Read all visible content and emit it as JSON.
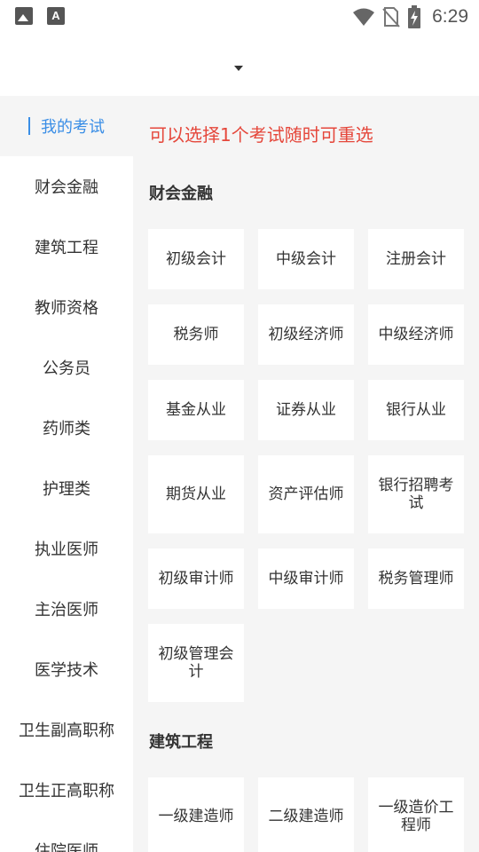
{
  "status_bar": {
    "time": "6:29",
    "left_icons": [
      "image-icon",
      "text-a-icon"
    ],
    "right_icons": [
      "wifi-icon",
      "no-sim-icon",
      "battery-charging-icon"
    ],
    "a_glyph": "A"
  },
  "header": {
    "title": "",
    "dropdown_icon": "caret-down-icon"
  },
  "sidebar": {
    "items": [
      {
        "label": "我的考试",
        "active": true
      },
      {
        "label": "财会金融"
      },
      {
        "label": "建筑工程"
      },
      {
        "label": "教师资格"
      },
      {
        "label": "公务员"
      },
      {
        "label": "药师类"
      },
      {
        "label": "护理类"
      },
      {
        "label": "执业医师"
      },
      {
        "label": "主治医师"
      },
      {
        "label": "医学技术"
      },
      {
        "label": "卫生副高职称"
      },
      {
        "label": "卫生正高职称"
      },
      {
        "label": "住院医师"
      }
    ],
    "active_color": "#3a8ee6"
  },
  "main": {
    "notice": "可以选择1个考试随时可重选",
    "notice_color": "#e5473b",
    "sections": [
      {
        "title": "财会金融",
        "items": [
          "初级会计",
          "中级会计",
          "注册会计",
          "税务师",
          "初级经济师",
          "中级经济师",
          "基金从业",
          "证券从业",
          "银行从业",
          "期货从业",
          "资产评估师",
          "银行招聘考试",
          "初级审计师",
          "中级审计师",
          "税务管理师",
          "初级管理会计"
        ]
      },
      {
        "title": "建筑工程",
        "items": [
          "一级建造师",
          "二级建造师",
          "一级造价工程师"
        ]
      }
    ]
  }
}
